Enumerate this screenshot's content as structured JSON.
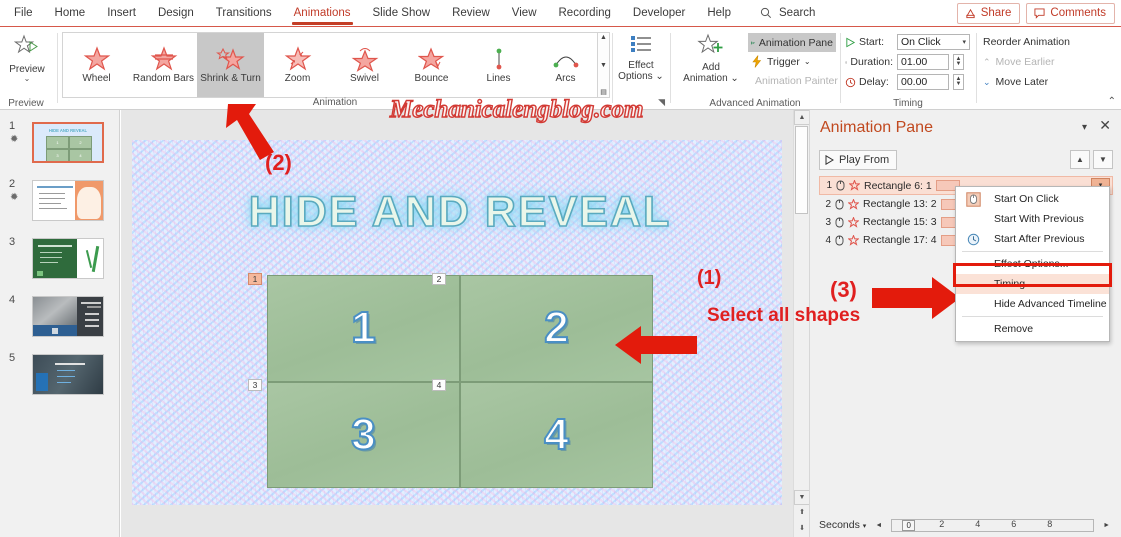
{
  "menu": {
    "items": [
      "File",
      "Home",
      "Insert",
      "Design",
      "Transitions",
      "Animations",
      "Slide Show",
      "Review",
      "View",
      "Recording",
      "Developer",
      "Help"
    ],
    "active": "Animations",
    "search_label": "Search",
    "share_label": "Share",
    "comments_label": "Comments"
  },
  "ribbon": {
    "preview": {
      "label": "Preview",
      "group_label": "Preview"
    },
    "gallery": {
      "group_label": "Animation",
      "items": [
        "Wheel",
        "Random Bars",
        "Shrink & Turn",
        "Zoom",
        "Swivel",
        "Bounce",
        "Lines",
        "Arcs"
      ],
      "selected": "Shrink & Turn"
    },
    "effect_options": {
      "line1": "Effect",
      "line2": "Options"
    },
    "advanced": {
      "group_label": "Advanced Animation",
      "add_animation_line1": "Add",
      "add_animation_line2": "Animation",
      "animation_pane": "Animation Pane",
      "trigger": "Trigger",
      "animation_painter": "Animation Painter"
    },
    "timing": {
      "group_label": "Timing",
      "start_label": "Start:",
      "start_value": "On Click",
      "duration_label": "Duration:",
      "duration_value": "01.00",
      "delay_label": "Delay:",
      "delay_value": "00.00"
    },
    "reorder": {
      "title": "Reorder Animation",
      "move_earlier": "Move Earlier",
      "move_later": "Move Later"
    }
  },
  "thumbnails": [
    {
      "number": "1",
      "starred": true,
      "selected": true
    },
    {
      "number": "2",
      "starred": true,
      "selected": false
    },
    {
      "number": "3",
      "starred": false,
      "selected": false
    },
    {
      "number": "4",
      "starred": false,
      "selected": false
    },
    {
      "number": "5",
      "starred": false,
      "selected": false
    }
  ],
  "slide": {
    "title": "HIDE AND REVEAL",
    "watermark": "Mechanicalengblog.com",
    "cells": [
      {
        "label": "1",
        "badge": "1",
        "badge_selected": true
      },
      {
        "label": "2",
        "badge": "2",
        "badge_selected": false
      },
      {
        "label": "3",
        "badge": "3",
        "badge_selected": false
      },
      {
        "label": "4",
        "badge": "4",
        "badge_selected": false
      }
    ]
  },
  "annotations": {
    "step1_num": "(1)",
    "step1_text": "Select all shapes",
    "step2_num": "(2)",
    "step3_num": "(3)"
  },
  "animation_pane": {
    "title": "Animation Pane",
    "play_from": "Play From",
    "rows": [
      {
        "index": "1",
        "label": "Rectangle 6: 1",
        "selected": true
      },
      {
        "index": "2",
        "label": "Rectangle 13: 2",
        "selected": false
      },
      {
        "index": "3",
        "label": "Rectangle 15: 3",
        "selected": false
      },
      {
        "index": "4",
        "label": "Rectangle 17: 4",
        "selected": false
      }
    ],
    "timeline": {
      "seconds_label": "Seconds",
      "zero": "0",
      "ticks": [
        "2",
        "4",
        "6",
        "8"
      ]
    }
  },
  "context_menu": {
    "items": [
      {
        "label": "Start On Click",
        "icon": "mouse-click-icon",
        "highlighted": false
      },
      {
        "label": "Start With Previous",
        "icon": "",
        "highlighted": false
      },
      {
        "label": "Start After Previous",
        "icon": "clock-icon",
        "highlighted": false
      },
      {
        "label": "Effect Options...",
        "icon": "",
        "highlighted": false
      },
      {
        "label": "Timing...",
        "icon": "",
        "highlighted": true
      },
      {
        "label": "Hide Advanced Timeline",
        "icon": "",
        "highlighted": false
      },
      {
        "label": "Remove",
        "icon": "",
        "highlighted": false
      }
    ]
  },
  "colors": {
    "accent": "#c13b28",
    "annotation_red": "#e02020",
    "selection_orange": "#e06a4c",
    "pane_bar": "#f6c8b9"
  }
}
